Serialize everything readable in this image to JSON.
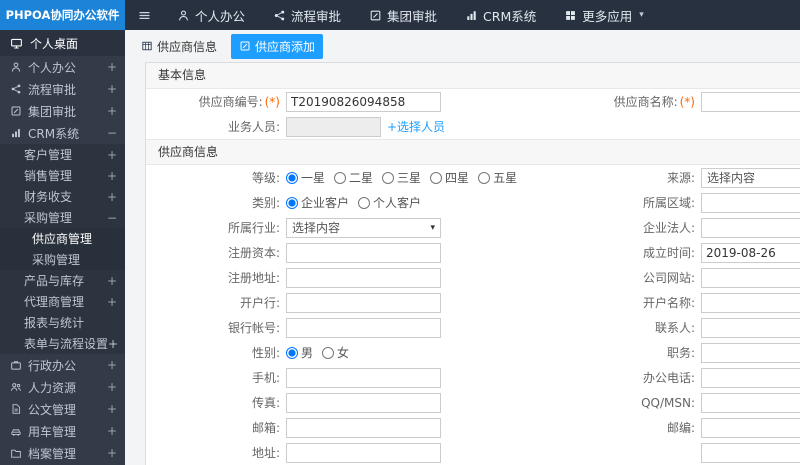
{
  "topbar": {
    "logo": "PHPOA协同办公软件",
    "nav": [
      {
        "label": "个人办公"
      },
      {
        "label": "流程审批"
      },
      {
        "label": "集团审批"
      },
      {
        "label": "CRM系统"
      },
      {
        "label": "更多应用"
      }
    ]
  },
  "icons": {
    "caret_down": "▾"
  },
  "sidebar": {
    "items": [
      {
        "label": "个人桌面",
        "suffix": ""
      },
      {
        "label": "个人办公",
        "suffix": "+"
      },
      {
        "label": "流程审批",
        "suffix": "+"
      },
      {
        "label": "集团审批",
        "suffix": "+"
      },
      {
        "label": "CRM系统",
        "suffix": "−"
      },
      {
        "label": "客户管理",
        "suffix": "+"
      },
      {
        "label": "销售管理",
        "suffix": "+"
      },
      {
        "label": "财务收支",
        "suffix": "+"
      },
      {
        "label": "采购管理",
        "suffix": "−"
      },
      {
        "label": "供应商管理",
        "suffix": ""
      },
      {
        "label": "采购管理",
        "suffix": ""
      },
      {
        "label": "产品与库存",
        "suffix": "+"
      },
      {
        "label": "代理商管理",
        "suffix": "+"
      },
      {
        "label": "报表与统计",
        "suffix": ""
      },
      {
        "label": "表单与流程设置+",
        "suffix": ""
      },
      {
        "label": "行政办公",
        "suffix": "+"
      },
      {
        "label": "人力资源",
        "suffix": "+"
      },
      {
        "label": "公文管理",
        "suffix": "+"
      },
      {
        "label": "用车管理",
        "suffix": "+"
      },
      {
        "label": "档案管理",
        "suffix": "+"
      }
    ]
  },
  "tabs": [
    {
      "label": "供应商信息"
    },
    {
      "label": "供应商添加"
    }
  ],
  "form": {
    "sections": [
      "基本信息",
      "供应商信息"
    ],
    "fields": {
      "supplier_no": {
        "label": "供应商编号:",
        "required": "(*)",
        "value": "T20190826094858"
      },
      "supplier_name": {
        "label": "供应商名称:",
        "required": "(*)",
        "value": ""
      },
      "staff": {
        "label": "业务人员:",
        "value": "",
        "link": "+选择人员"
      },
      "level": {
        "label": "等级:",
        "options": [
          "一星",
          "二星",
          "三星",
          "四星",
          "五星"
        ],
        "selected": 0
      },
      "source": {
        "label": "来源:",
        "value": "选择内容"
      },
      "category": {
        "label": "类别:",
        "options": [
          "企业客户",
          "个人客户"
        ],
        "selected": 0
      },
      "region": {
        "label": "所属区域:",
        "value": ""
      },
      "industry": {
        "label": "所属行业:",
        "value": "选择内容"
      },
      "legal": {
        "label": "企业法人:",
        "value": ""
      },
      "capital": {
        "label": "注册资本:",
        "value": ""
      },
      "founded": {
        "label": "成立时间:",
        "value": "2019-08-26"
      },
      "reg_addr": {
        "label": "注册地址:",
        "value": ""
      },
      "website": {
        "label": "公司网站:",
        "value": ""
      },
      "bank": {
        "label": "开户行:",
        "value": ""
      },
      "account_name": {
        "label": "开户名称:",
        "value": ""
      },
      "bank_no": {
        "label": "银行帐号:",
        "value": ""
      },
      "contact": {
        "label": "联系人:",
        "value": ""
      },
      "gender": {
        "label": "性别:",
        "options": [
          "男",
          "女"
        ],
        "selected": 0
      },
      "title": {
        "label": "职务:",
        "value": ""
      },
      "mobile": {
        "label": "手机:",
        "value": ""
      },
      "office_tel": {
        "label": "办公电话:",
        "value": ""
      },
      "fax": {
        "label": "传真:",
        "value": ""
      },
      "qq": {
        "label": "QQ/MSN:",
        "value": ""
      },
      "email": {
        "label": "邮箱:",
        "value": ""
      },
      "zip": {
        "label": "邮编:",
        "value": ""
      },
      "address": {
        "label": "地址:",
        "value": ""
      },
      "extra": {
        "label": "",
        "value": ""
      }
    }
  }
}
